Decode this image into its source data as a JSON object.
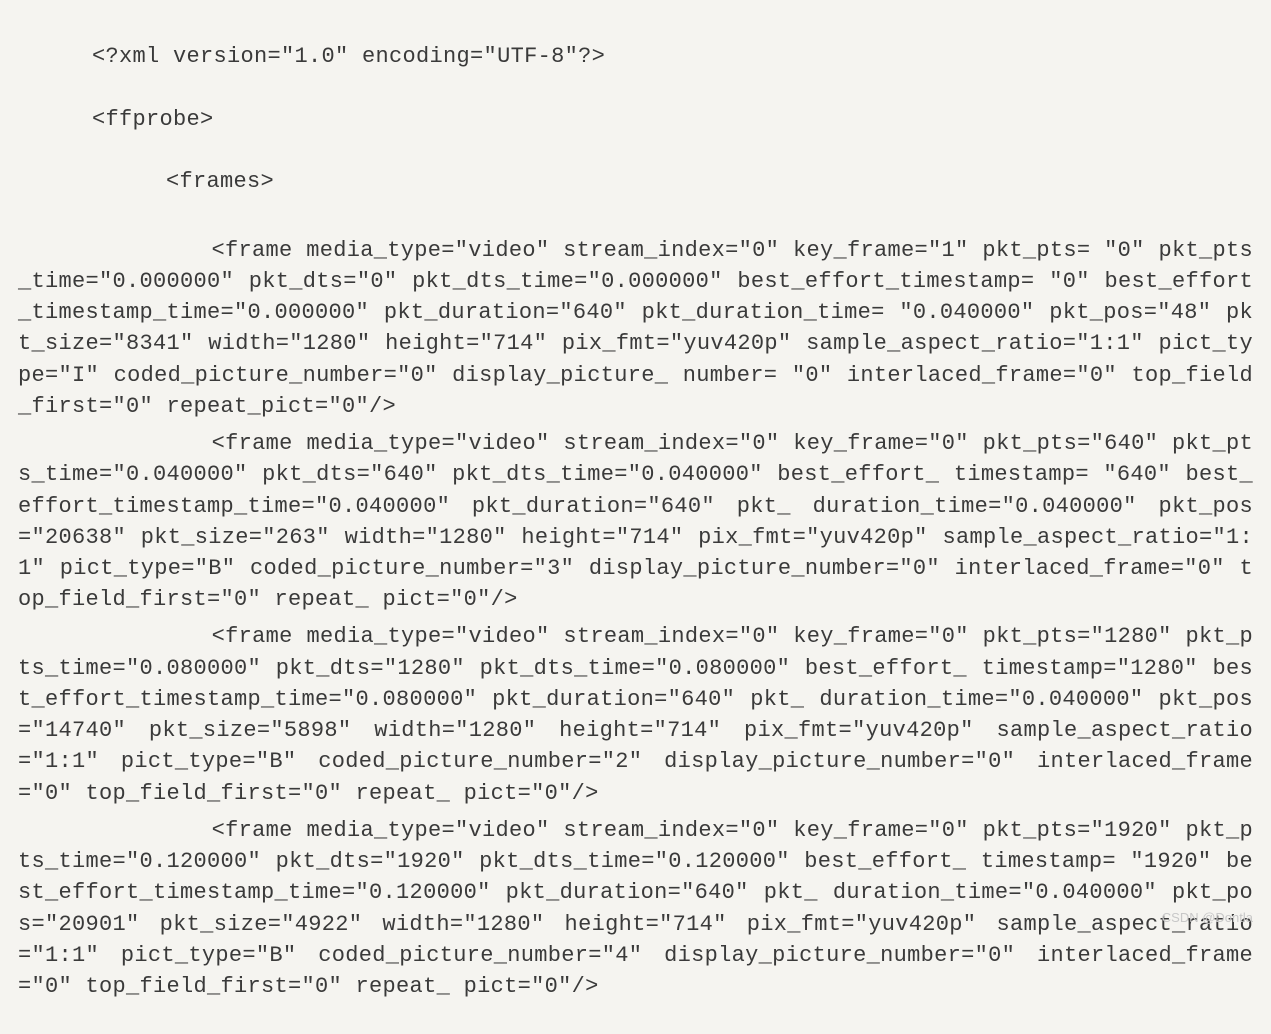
{
  "xml_header": "<?xml version=\"1.0\" encoding=\"UTF-8\"?>",
  "root_open": "<ffprobe>",
  "frames_open": "<frames>",
  "frames": [
    {
      "media_type": "video",
      "stream_index": "0",
      "key_frame": "1",
      "pkt_pts": "0",
      "pkt_pts_time": "0.000000",
      "pkt_dts": "0",
      "pkt_dts_time": "0.000000",
      "best_effort_timestamp": "0",
      "best_effort_timestamp_time": "0.000000",
      "pkt_duration": "640",
      "pkt_duration_time": "0.040000",
      "pkt_pos": "48",
      "pkt_size": "8341",
      "width": "1280",
      "height": "714",
      "pix_fmt": "yuv420p",
      "sample_aspect_ratio": "1:1",
      "pict_type": "I",
      "coded_picture_number": "0",
      "display_picture_number": "0",
      "interlaced_frame": "0",
      "top_field_first": "0",
      "repeat_pict": "0"
    },
    {
      "media_type": "video",
      "stream_index": "0",
      "key_frame": "0",
      "pkt_pts": "640",
      "pkt_pts_time": "0.040000",
      "pkt_dts": "640",
      "pkt_dts_time": "0.040000",
      "best_effort_timestamp": "640",
      "best_effort_timestamp_time": "0.040000",
      "pkt_duration": "640",
      "pkt_duration_time": "0.040000",
      "pkt_pos": "20638",
      "pkt_size": "263",
      "width": "1280",
      "height": "714",
      "pix_fmt": "yuv420p",
      "sample_aspect_ratio": "1:1",
      "pict_type": "B",
      "coded_picture_number": "3",
      "display_picture_number": "0",
      "interlaced_frame": "0",
      "top_field_first": "0",
      "repeat_pict": "0"
    },
    {
      "media_type": "video",
      "stream_index": "0",
      "key_frame": "0",
      "pkt_pts": "1280",
      "pkt_pts_time": "0.080000",
      "pkt_dts": "1280",
      "pkt_dts_time": "0.080000",
      "best_effort_timestamp": "1280",
      "best_effort_timestamp_time": "0.080000",
      "pkt_duration": "640",
      "pkt_duration_time": "0.040000",
      "pkt_pos": "14740",
      "pkt_size": "5898",
      "width": "1280",
      "height": "714",
      "pix_fmt": "yuv420p",
      "sample_aspect_ratio": "1:1",
      "pict_type": "B",
      "coded_picture_number": "2",
      "display_picture_number": "0",
      "interlaced_frame": "0",
      "top_field_first": "0",
      "repeat_pict": "0"
    },
    {
      "media_type": "video",
      "stream_index": "0",
      "key_frame": "0",
      "pkt_pts": "1920",
      "pkt_pts_time": "0.120000",
      "pkt_dts": "1920",
      "pkt_dts_time": "0.120000",
      "best_effort_timestamp": "1920",
      "best_effort_timestamp_time": "0.120000",
      "pkt_duration": "640",
      "pkt_duration_time": "0.040000",
      "pkt_pos": "20901",
      "pkt_size": "4922",
      "width": "1280",
      "height": "714",
      "pix_fmt": "yuv420p",
      "sample_aspect_ratio": "1:1",
      "pict_type": "B",
      "coded_picture_number": "4",
      "display_picture_number": "0",
      "interlaced_frame": "0",
      "top_field_first": "0",
      "repeat_pict": "0"
    }
  ],
  "watermark": "CSDN @Dontla"
}
